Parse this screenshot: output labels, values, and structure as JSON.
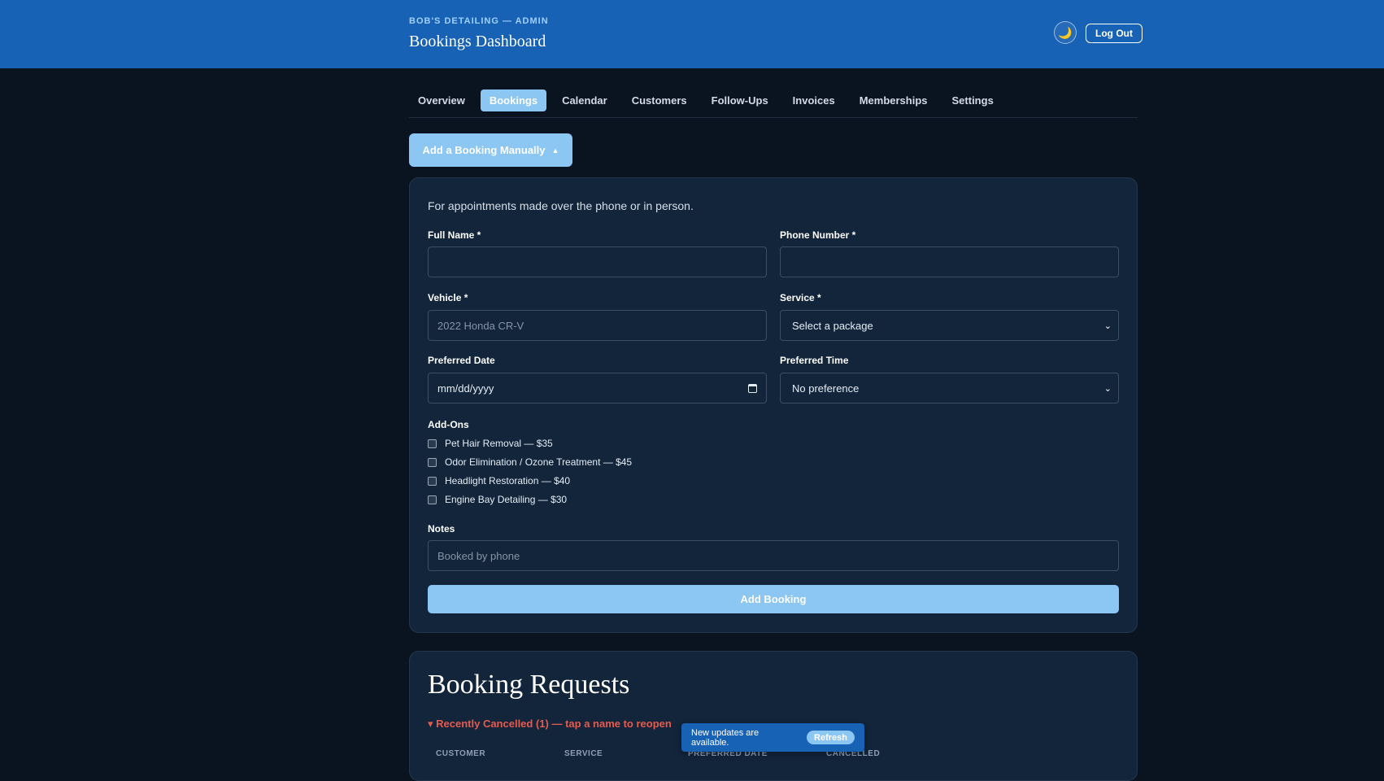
{
  "header": {
    "kicker": "BOB'S DETAILING — ADMIN",
    "title": "Bookings Dashboard",
    "theme_icon": "moon-icon",
    "logout_label": "Log Out"
  },
  "tabs": [
    {
      "label": "Overview",
      "active": false
    },
    {
      "label": "Bookings",
      "active": true
    },
    {
      "label": "Calendar",
      "active": false
    },
    {
      "label": "Customers",
      "active": false
    },
    {
      "label": "Follow-Ups",
      "active": false
    },
    {
      "label": "Invoices",
      "active": false
    },
    {
      "label": "Memberships",
      "active": false
    },
    {
      "label": "Settings",
      "active": false
    }
  ],
  "manual_booking": {
    "toggle_label": "Add a Booking Manually",
    "intro": "For appointments made over the phone or in person.",
    "full_name_label": "Full Name *",
    "full_name_value": "",
    "phone_label": "Phone Number *",
    "phone_value": "",
    "vehicle_label": "Vehicle *",
    "vehicle_placeholder": "2022 Honda CR-V",
    "service_label": "Service *",
    "service_selected": "Select a package",
    "date_label": "Preferred Date",
    "date_placeholder": "mm/dd/yyyy",
    "time_label": "Preferred Time",
    "time_selected": "No preference",
    "addons_label": "Add-Ons",
    "addons": [
      {
        "label": "Pet Hair Removal — $35",
        "checked": false
      },
      {
        "label": "Odor Elimination / Ozone Treatment — $45",
        "checked": false
      },
      {
        "label": "Headlight Restoration — $40",
        "checked": false
      },
      {
        "label": "Engine Bay Detailing — $30",
        "checked": false
      }
    ],
    "notes_label": "Notes",
    "notes_placeholder": "Booked by phone",
    "submit_label": "Add Booking"
  },
  "requests": {
    "title": "Booking Requests",
    "cancelled_toggle": "▾ Recently Cancelled (1) — tap a name to reopen",
    "columns": [
      "CUSTOMER",
      "SERVICE",
      "PREFERRED DATE",
      "CANCELLED"
    ]
  },
  "toast": {
    "text": "New updates are available.",
    "refresh_label": "Refresh"
  },
  "colors": {
    "header_bg": "#1862b5",
    "page_bg": "#0a1320",
    "card_bg": "#12253b",
    "accent": "#8cc6f2",
    "cancelled_red": "#e55b4e"
  }
}
